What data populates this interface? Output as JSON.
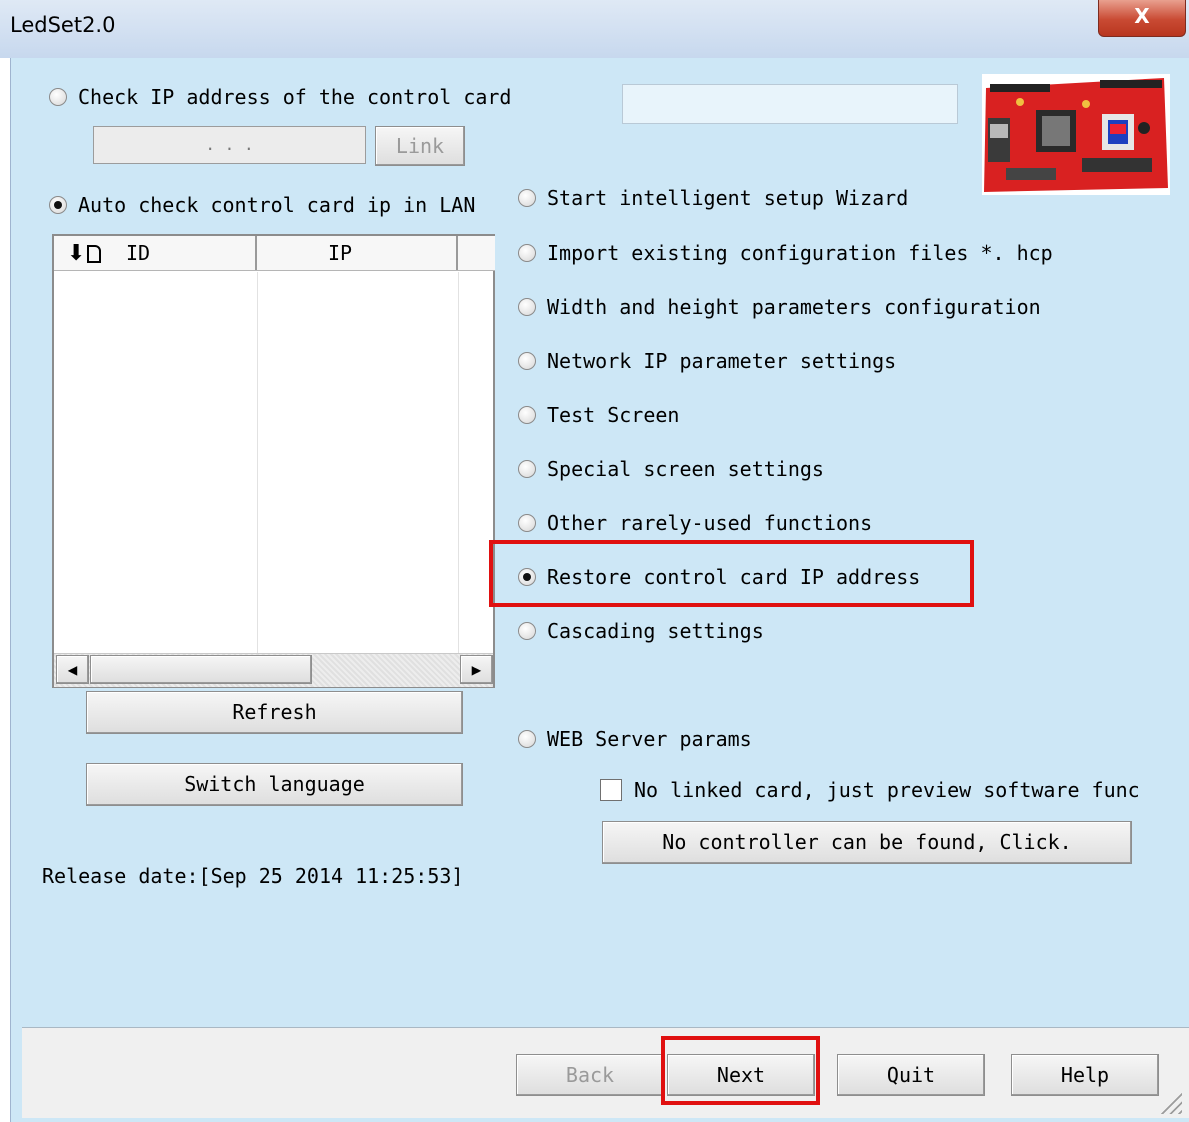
{
  "window": {
    "title": "LedSet2.0",
    "close_label": "X"
  },
  "left": {
    "check_ip_label": "Check IP address of the control card",
    "ip_placeholder": ".        .        .",
    "link_label": "Link",
    "auto_check_label": "Auto check control card ip in LAN",
    "table": {
      "columns": [
        "ID",
        "IP"
      ],
      "rows": []
    },
    "refresh_label": "Refresh",
    "switch_language_label": "Switch language",
    "release_date": "Release date:[Sep 25 2014 11:25:53]"
  },
  "options": [
    {
      "label": "Start intelligent setup Wizard",
      "selected": false
    },
    {
      "label": "Import existing configuration files *. hcp",
      "selected": false
    },
    {
      "label": "Width and height parameters configuration",
      "selected": false
    },
    {
      "label": "Network IP parameter settings",
      "selected": false
    },
    {
      "label": "Test Screen",
      "selected": false
    },
    {
      "label": "Special screen settings",
      "selected": false
    },
    {
      "label": "Other rarely-used functions",
      "selected": false
    },
    {
      "label": "Restore control card IP address",
      "selected": true
    },
    {
      "label": "Cascading settings",
      "selected": false
    },
    {
      "label": "WEB Server params",
      "selected": false
    }
  ],
  "preview": {
    "checkbox_label": "No linked card, just preview software func",
    "checked": false,
    "no_controller_label": "No controller can be found, Click."
  },
  "footer": {
    "back_label": "Back",
    "next_label": "Next",
    "quit_label": "Quit",
    "help_label": "Help"
  },
  "colors": {
    "client_bg": "#cde7f6",
    "highlight": "#e01010",
    "board_red": "#d92121"
  },
  "icons": {
    "sort": "sort-down-icon",
    "board": "control-card-image"
  }
}
